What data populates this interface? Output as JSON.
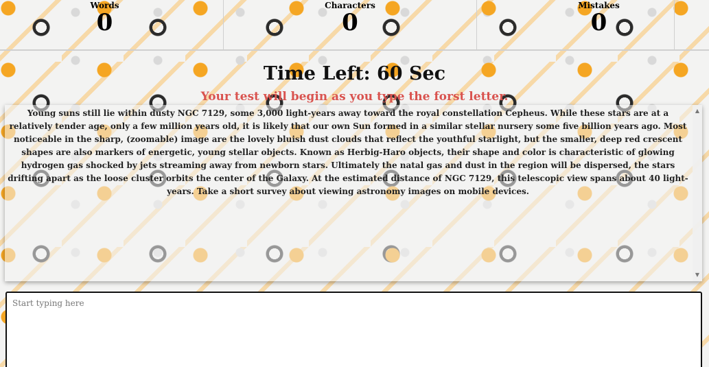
{
  "stats": {
    "words_label": "Words",
    "words_value": "0",
    "characters_label": "Characters",
    "characters_value": "0",
    "mistakes_label": "Mistakes",
    "mistakes_value": "0"
  },
  "timer": {
    "text": "Time Left: 60 Sec"
  },
  "notice": {
    "text": "Your test will begin as you type the forst letter."
  },
  "passage": {
    "text": "Young suns still lie within dusty NGC 7129, some 3,000 light-years away toward the royal constellation Cepheus. While these stars are at a relatively tender age, only a few million years old, it is likely that our own Sun formed in a similar stellar nursery some five billion years ago. Most noticeable in the sharp, (zoomable) image are the lovely bluish dust clouds that reflect the youthful starlight, but the smaller, deep red crescent shapes are also markers of energetic, young stellar objects. Known as Herbig-Haro objects, their shape and color is characteristic of glowing hydrogen gas shocked by jets streaming away from newborn stars. Ultimately the natal gas and dust in the region will be dispersed, the stars drifting apart as the loose cluster orbits the center of the Galaxy. At the estimated distance of NGC 7129, this telescopic view spans about 40 light-years. Take a short survey about viewing astronomy images on mobile devices."
  },
  "input": {
    "placeholder": "Start typing here",
    "value": ""
  },
  "icons": {
    "scroll_up": "scroll-up-arrow-icon",
    "scroll_down": "scroll-down-arrow-icon"
  },
  "colors": {
    "notice": "#d9534f",
    "accent_yellow": "#f5a623"
  }
}
